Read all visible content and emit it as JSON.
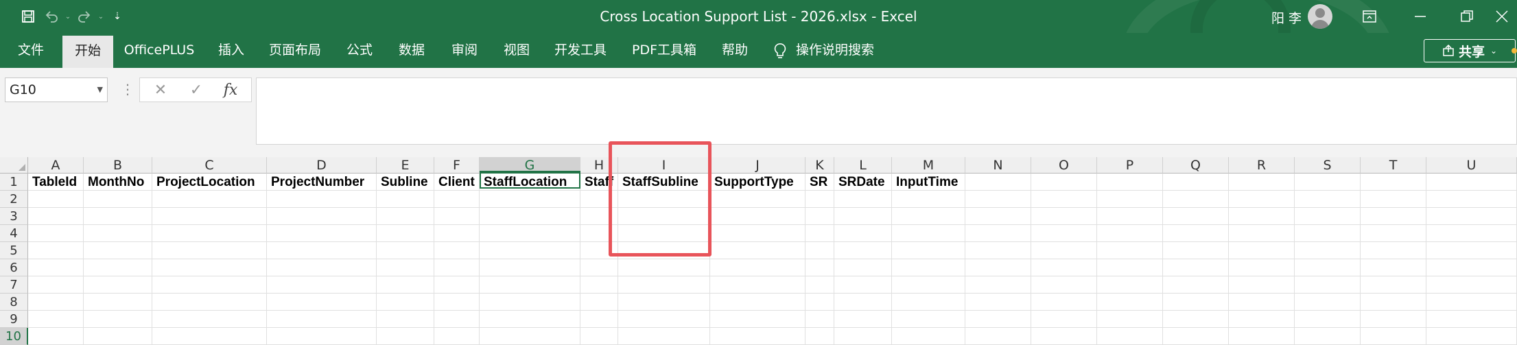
{
  "window": {
    "title": "Cross Location Support List - 2026.xlsx  -  Excel",
    "user": "阳 李"
  },
  "ribbon": {
    "tabs": [
      "文件",
      "开始",
      "OfficePLUS",
      "插入",
      "页面布局",
      "公式",
      "数据",
      "审阅",
      "视图",
      "开发工具",
      "PDF工具箱",
      "帮助"
    ],
    "active_tab": "开始",
    "tell_me": "操作说明搜索",
    "share_label": "共享"
  },
  "formula_bar": {
    "name_box": "G10",
    "fx_label": "fx",
    "content": ""
  },
  "sheet": {
    "columns": [
      "A",
      "B",
      "C",
      "D",
      "E",
      "F",
      "G",
      "H",
      "I",
      "J",
      "K",
      "L",
      "M",
      "N",
      "O",
      "P",
      "Q",
      "R",
      "S",
      "T",
      "U"
    ],
    "rows": [
      "1",
      "2",
      "3",
      "4",
      "5",
      "6",
      "7",
      "8",
      "9",
      "10"
    ],
    "selected_column": "G",
    "selected_row": "10",
    "header_row": [
      "TableId",
      "MonthNo",
      "ProjectLocation",
      "ProjectNumber",
      "Subline",
      "Client",
      "StaffLocation",
      "Staff",
      "StaffSubline",
      "SupportType",
      "SR",
      "SRDate",
      "InputTime"
    ]
  },
  "annotation": {
    "color": "#e8545a",
    "target_column": "I"
  },
  "colors": {
    "excel_green": "#217346"
  }
}
